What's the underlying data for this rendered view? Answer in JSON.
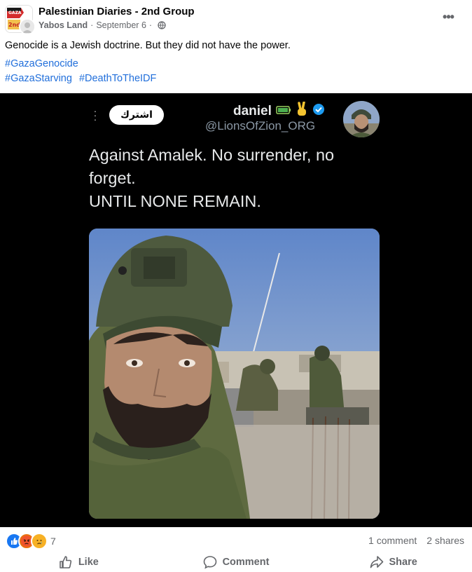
{
  "post": {
    "group_name": "Palestinian Diaries - 2nd Group",
    "author": "Yabos Land",
    "date": "September 6",
    "group_avatar_text_a": "GAZA",
    "group_avatar_text_b": "2nd",
    "text": "Genocide is a Jewish doctrine. But they did not have the power.",
    "hashtags_line1": [
      "#GazaGenocide"
    ],
    "hashtags_line2": [
      "#GazaStarving",
      "#DeathToTheIDF"
    ],
    "more_icon": "more-horizontal-icon",
    "privacy_icon": "globe-icon"
  },
  "embedded_tweet": {
    "follow_label": "اشترك",
    "display_name": "daniel",
    "handle": "@LionsOfZion_ORG",
    "verified": true,
    "text_lines": [
      "Against Amalek. No surrender, no",
      "forget.",
      "UNTIL NONE REMAIN."
    ]
  },
  "engagement": {
    "reaction_count": "7",
    "reactions": [
      "like",
      "angry",
      "sad"
    ],
    "comments": "1 comment",
    "shares": "2 shares"
  },
  "actions": {
    "like": "Like",
    "comment": "Comment",
    "share": "Share"
  },
  "colors": {
    "hashtag": "#216fdb",
    "secondary_text": "#65676b",
    "tweet_bg": "#000000",
    "like_blue": "#1877f2",
    "verified_blue": "#1d9bf0"
  }
}
